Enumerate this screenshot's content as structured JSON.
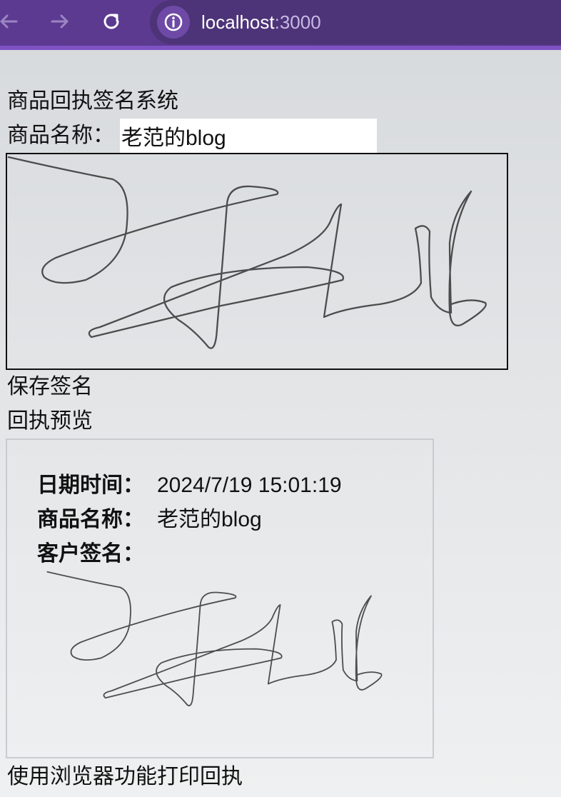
{
  "browser": {
    "url_host": "localhost",
    "url_port": ":3000",
    "icons": {
      "back": "arrow-left-icon",
      "forward": "arrow-right-icon",
      "reload": "reload-icon",
      "site_info": "info-icon"
    }
  },
  "page": {
    "title": "商品回执签名系统",
    "product_label": "商品名称：",
    "product_value": "老范的blog",
    "save_button": "保存签名",
    "preview_title": "回执预览",
    "print_hint": "使用浏览器功能打印回执"
  },
  "receipt": {
    "date_label": "日期时间：",
    "date_value": "2024/7/19 15:01:19",
    "product_label": "商品名称：",
    "product_value": "老范的blog",
    "signature_label": "客户签名："
  }
}
